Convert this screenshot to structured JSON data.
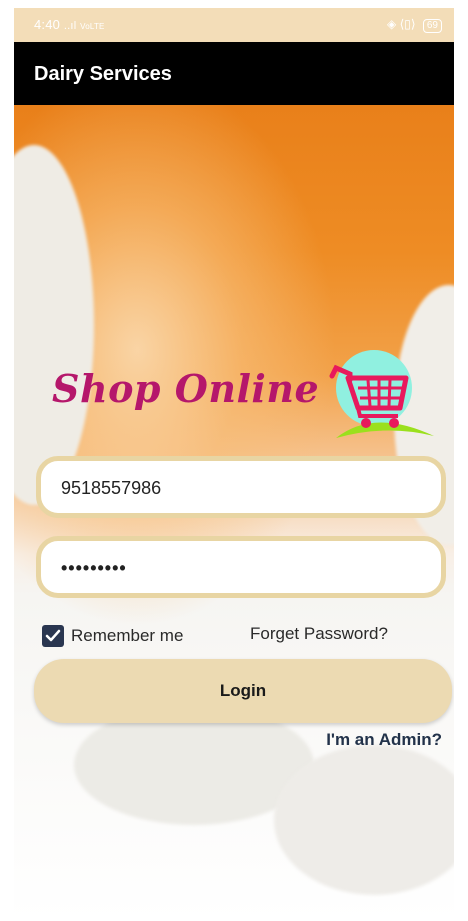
{
  "status_bar": {
    "time": "4:40",
    "signal": "..ıl",
    "network": "VoLTE",
    "battery": "69"
  },
  "app_bar": {
    "title": "Dairy Services"
  },
  "logo": {
    "text": "Shop Online"
  },
  "login_form": {
    "username_value": "9518557986",
    "password_value": "•••••••••",
    "remember_label": "Remember me",
    "remember_checked": true,
    "forget_label": "Forget Password?",
    "login_label": "Login",
    "admin_label": "I'm an Admin?"
  },
  "colors": {
    "field_border": "#e8d5a3",
    "button_bg": "#ecdab2",
    "checkbox": "#2a3650",
    "logo_text": "#b5176b",
    "cart": "#e8195c",
    "cart_circle": "#90f0e0",
    "cart_swoosh": "#9be01d",
    "admin_text": "#22324a"
  }
}
